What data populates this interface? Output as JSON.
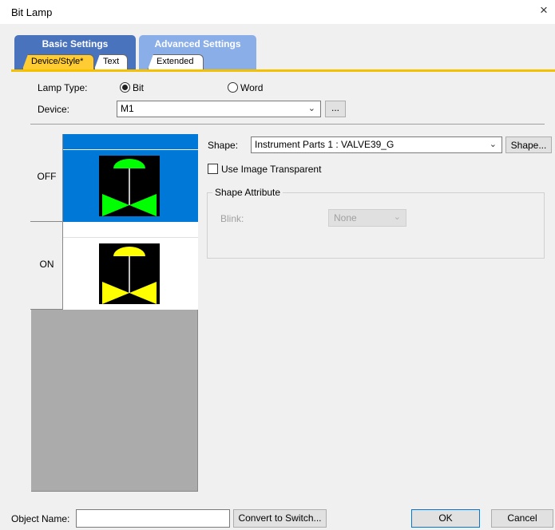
{
  "window": {
    "title": "Bit Lamp",
    "close_glyph": "×"
  },
  "tabs": {
    "basic": {
      "label": "Basic Settings",
      "sub": [
        "Device/Style*",
        "Text"
      ]
    },
    "advanced": {
      "label": "Advanced Settings",
      "sub": [
        "Extended"
      ]
    }
  },
  "lamp_type": {
    "label": "Lamp Type:",
    "options": [
      "Bit",
      "Word"
    ],
    "selected": "Bit"
  },
  "device": {
    "label": "Device:",
    "value": "M1",
    "browse_label": "..."
  },
  "states": [
    {
      "label": "OFF",
      "color": "#00ff00"
    },
    {
      "label": "ON",
      "color": "#ffff00"
    }
  ],
  "shape": {
    "label": "Shape:",
    "value": "Instrument Parts 1 : VALVE39_G",
    "button_label": "Shape..."
  },
  "transparent": {
    "label": "Use Image Transparent",
    "checked": false
  },
  "shape_attribute": {
    "title": "Shape Attribute",
    "blink_label": "Blink:",
    "blink_value": "None"
  },
  "footer": {
    "object_name_label": "Object Name:",
    "object_name_value": "",
    "convert_label": "Convert to Switch...",
    "ok_label": "OK",
    "cancel_label": "Cancel"
  },
  "colors": {
    "selection": "#0078d7",
    "tab_basic": "#4a73be",
    "tab_advanced": "#8aaee8",
    "accent": "#f5c000"
  }
}
